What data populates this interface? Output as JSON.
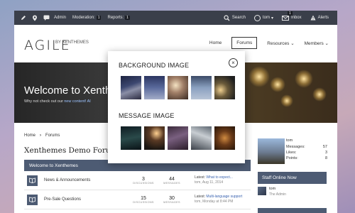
{
  "admin_bar": {
    "admin": "Admin",
    "moderation": "Moderation:",
    "moderation_count": "1",
    "reports": "Reports:",
    "reports_count": "1",
    "search": "Search",
    "user": "tom",
    "inbox": "Inbox",
    "inbox_count": "1",
    "alerts": "Alerts"
  },
  "header": {
    "logo": "AGILE",
    "byline": "BY XENTHEMES",
    "nav": [
      "Home",
      "Forums",
      "Resources",
      "Members"
    ]
  },
  "hero": {
    "title": "Welcome to Xenth",
    "subtitle_prefix": "Why not check out our ",
    "subtitle_link": "new content! Al"
  },
  "breadcrumb": [
    "Home",
    "Forums"
  ],
  "forum_title": "Xenthemes Demo Forum",
  "category": "Welcome to Xenthemes",
  "nodes": [
    {
      "name": "News & Announcements",
      "discussions": "3",
      "messages": "44",
      "discussions_label": "DISCUSSIONS",
      "messages_label": "MESSAGES",
      "latest_label": "Latest:",
      "latest_title": "What to expect...",
      "latest_meta": "tom, Aug 11, 2014"
    },
    {
      "name": "Pre-Sale Questions",
      "discussions": "15",
      "messages": "30",
      "discussions_label": "DISCUSSIONS",
      "messages_label": "MESSAGES",
      "latest_label": "Latest:",
      "latest_title": "Multi-language support",
      "latest_meta": "tom, Monday at 8:44 PM"
    }
  ],
  "sidebar": {
    "user": "tom",
    "stats": [
      {
        "label": "Messages:",
        "value": "57"
      },
      {
        "label": "Likes:",
        "value": "3"
      },
      {
        "label": "Points:",
        "value": "8"
      }
    ],
    "staff_title": "Staff Online Now",
    "staff_name": "tom",
    "staff_role": "The Admin"
  },
  "popup": {
    "background_title": "BACKGROUND IMAGE",
    "message_title": "MESSAGE IMAGE"
  },
  "colors": {
    "accent": "#4d5b73",
    "admin_bar": "#3a3f4a",
    "link": "#3b64b0"
  }
}
